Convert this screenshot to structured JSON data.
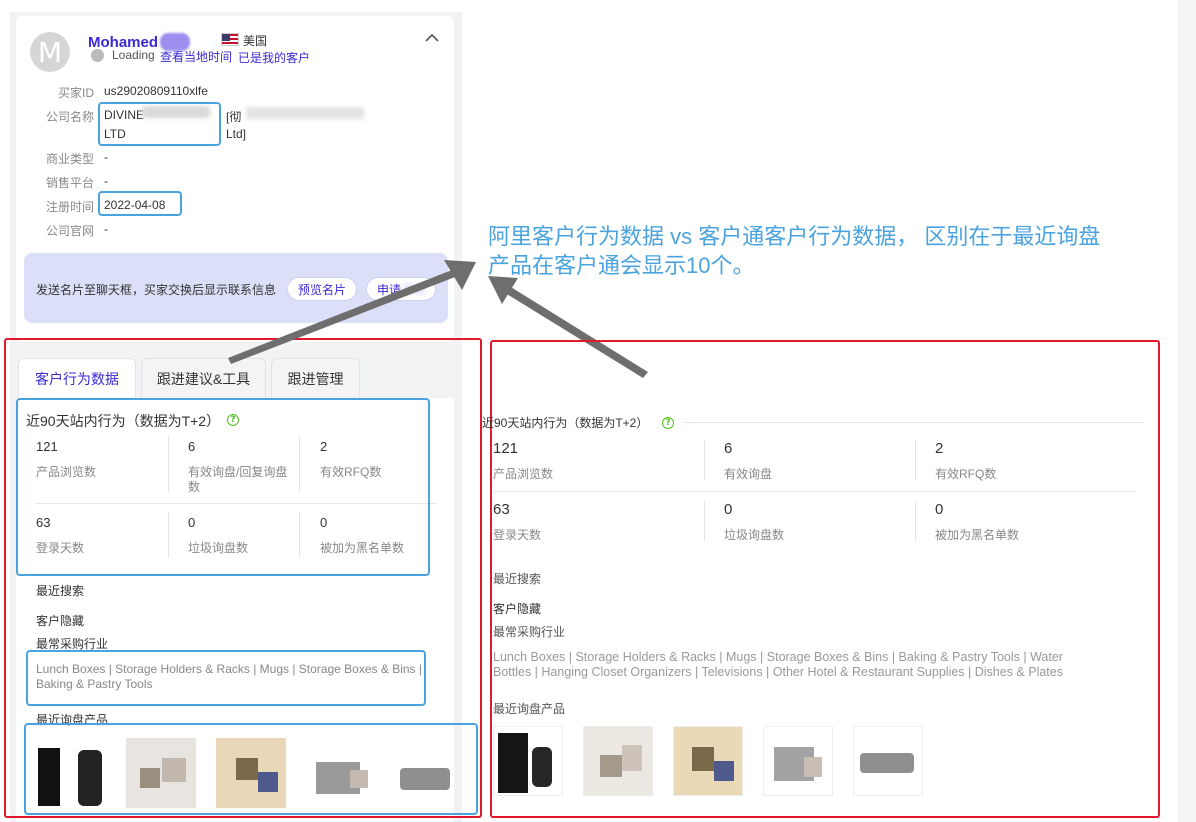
{
  "profile": {
    "avatar_letter": "M",
    "name": "Mohamed",
    "country": "美国",
    "status": "Loading",
    "local_time_link": "查看当地时间",
    "my_customer_link": "已是我的客户",
    "fields": [
      {
        "label": "买家ID",
        "value": "us29020809110xlfe"
      },
      {
        "label": "公司名称",
        "value": "DIVINE",
        "value_line2": "LTD",
        "value_extra": "[彻",
        "value_extra_line2": "Ltd]"
      },
      {
        "label": "商业类型",
        "value": "-"
      },
      {
        "label": "销售平台",
        "value": "-"
      },
      {
        "label": "注册时间",
        "value": "2022-04-08"
      },
      {
        "label": "公司官网",
        "value": "-"
      }
    ],
    "notice": "发送名片至聊天框，买家交换后显示联系信息",
    "preview_button": "预览名片",
    "apply_button": "申请"
  },
  "tabs": [
    {
      "label": "客户行为数据",
      "active": true
    },
    {
      "label": "跟进建议&工具",
      "active": false
    },
    {
      "label": "跟进管理",
      "active": false
    }
  ],
  "left_behavior": {
    "title": "近90天站内行为（数据为T+2）",
    "help": "?",
    "stats_row1": [
      {
        "value": "121",
        "label": "产品浏览数"
      },
      {
        "value": "6",
        "label": "有效询盘/回复询盘",
        "label_line2": "数"
      },
      {
        "value": "2",
        "label": "有效RFQ数"
      }
    ],
    "stats_row2": [
      {
        "value": "63",
        "label": "登录天数"
      },
      {
        "value": "0",
        "label": "垃圾询盘数"
      },
      {
        "value": "0",
        "label": "被加为黑名单数"
      }
    ],
    "recent_search_label": "最近搜索",
    "hidden_label": "客户隐藏",
    "industry_label": "最常采购行业",
    "industry_line1": "Lunch Boxes | Storage Holders & Racks | Mugs | Storage Boxes & Bins |",
    "industry_line2": "Baking & Pastry Tools",
    "recent_inquiry_label": "最近询盘产品"
  },
  "annotation": {
    "line1": "阿里客户行为数据 vs  客户通客户行为数据， 区别在于最近询盘",
    "line2": "产品在客户通会显示10个。"
  },
  "right_behavior": {
    "title": "近90天站内行为（数据为T+2）",
    "help": "?",
    "stats_row1": [
      {
        "value": "121",
        "label": "产品浏览数"
      },
      {
        "value": "6",
        "label": "有效询盘"
      },
      {
        "value": "2",
        "label": "有效RFQ数"
      }
    ],
    "stats_row2": [
      {
        "value": "63",
        "label": "登录天数"
      },
      {
        "value": "0",
        "label": "垃圾询盘数"
      },
      {
        "value": "0",
        "label": "被加为黑名单数"
      }
    ],
    "recent_search_label": "最近搜索",
    "hidden_label": "客户隐藏",
    "industry_label": "最常采购行业",
    "industry_line1": "Lunch Boxes | Storage Holders & Racks | Mugs | Storage Boxes & Bins | Baking & Pastry Tools | Water",
    "industry_line2": "Bottles | Hanging Closet Organizers | Televisions | Other Hotel & Restaurant Supplies | Dishes & Plates",
    "recent_inquiry_label": "最近询盘产品"
  },
  "colors": {
    "accent": "#3a2ad6",
    "annotation_blue": "#4aa3df",
    "annotation_red": "#e0192e",
    "help_green": "#52c41a"
  }
}
